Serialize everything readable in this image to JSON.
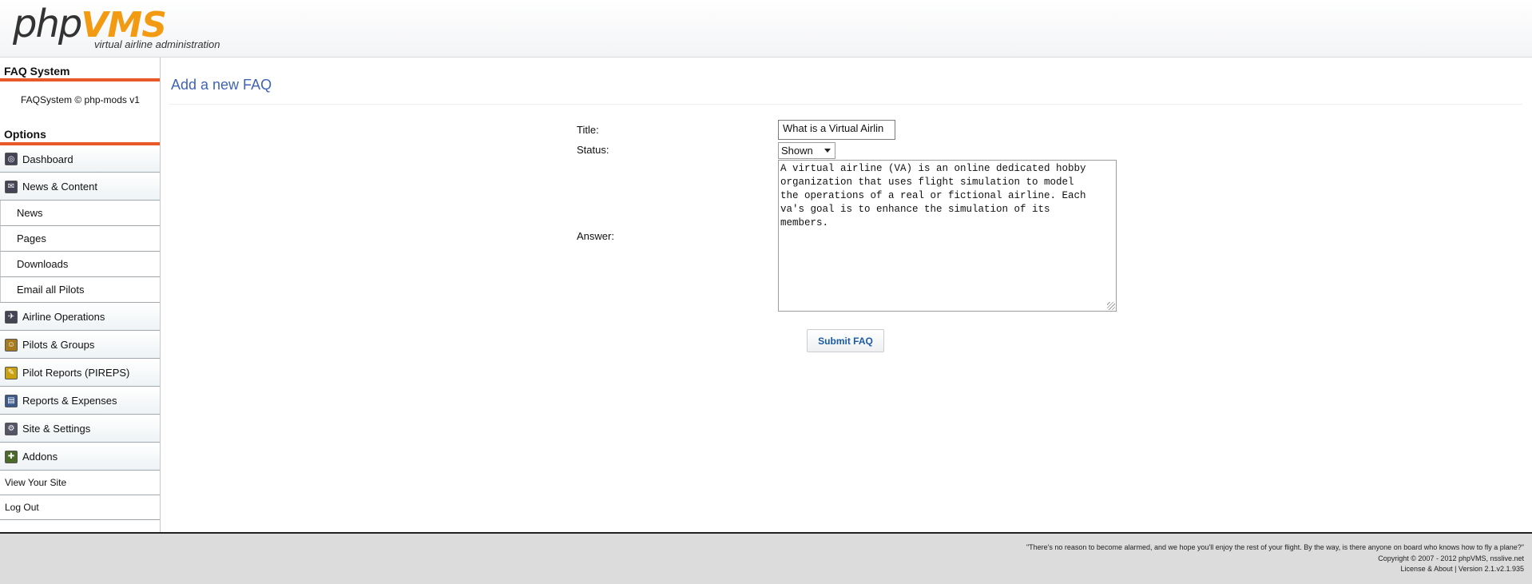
{
  "header": {
    "logo_text_1": "php",
    "logo_text_2": "VMS",
    "logo_sub": "virtual airline administration"
  },
  "sidebar": {
    "section_title": "FAQ System",
    "credit": "FAQSystem © php-mods v1",
    "options_title": "Options",
    "items": [
      {
        "label": "Dashboard",
        "icon": "dashboard-icon",
        "type": "main"
      },
      {
        "label": "News & Content",
        "icon": "news-icon",
        "type": "main"
      },
      {
        "label": "News",
        "type": "sub"
      },
      {
        "label": "Pages",
        "type": "sub"
      },
      {
        "label": "Downloads",
        "type": "sub"
      },
      {
        "label": "Email all Pilots",
        "type": "sub"
      },
      {
        "label": "Airline Operations",
        "icon": "airline-icon",
        "type": "main"
      },
      {
        "label": "Pilots & Groups",
        "icon": "pilots-icon",
        "type": "main"
      },
      {
        "label": "Pilot Reports (PIREPS)",
        "icon": "pireps-icon",
        "type": "main"
      },
      {
        "label": "Reports & Expenses",
        "icon": "reports-icon",
        "type": "main"
      },
      {
        "label": "Site & Settings",
        "icon": "settings-icon",
        "type": "main"
      },
      {
        "label": "Addons",
        "icon": "addons-icon",
        "type": "main"
      },
      {
        "label": "View Your Site",
        "type": "plain"
      },
      {
        "label": "Log Out",
        "type": "plain"
      }
    ]
  },
  "main": {
    "page_title": "Add a new FAQ",
    "form": {
      "title_label": "Title:",
      "title_value": "What is a Virtual Airlin",
      "status_label": "Status:",
      "status_value": "Shown",
      "answer_label": "Answer:",
      "answer_value": "A virtual airline (VA) is an online dedicated hobby\norganization that uses flight simulation to model\nthe operations of a real or fictional airline. Each\nva's goal is to enhance the simulation of its\nmembers.",
      "submit_label": "Submit FAQ"
    }
  },
  "footer": {
    "quote": "\"There's no reason to become alarmed, and we hope you'll enjoy the rest of your flight. By the way, is there anyone on board who knows how to fly a plane?\"",
    "copyright": "Copyright © 2007 - 2012 phpVMS, nsslive.net",
    "license": "License & About | Version 2.1.v2.1.935"
  },
  "colors": {
    "accent_orange": "#e8592a",
    "logo_orange": "#f29a12",
    "title_blue": "#3f63b8"
  }
}
